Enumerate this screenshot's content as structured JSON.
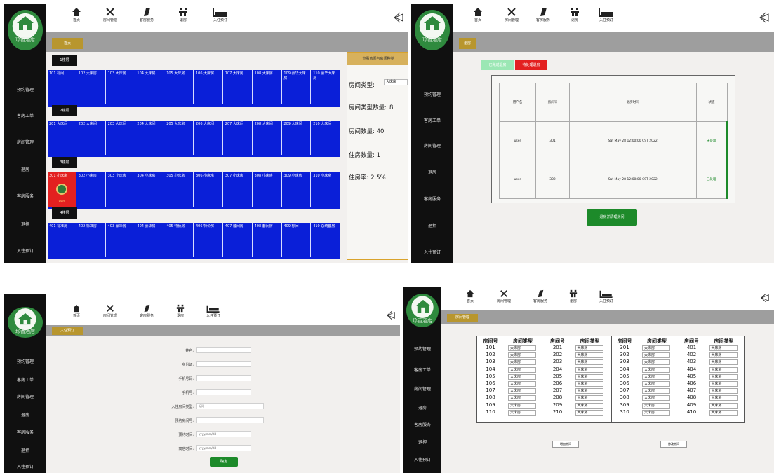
{
  "colors": {
    "sidebar": "#101010",
    "room_blue": "#0a1fd8",
    "occupied_red": "#e32020",
    "tab_gold": "#b8962e",
    "green": "#1d8a2a"
  },
  "brand": "珍香酒店",
  "toolbar": [
    {
      "icon": "home-icon",
      "label": "首页"
    },
    {
      "icon": "tools-icon",
      "label": "房间管理"
    },
    {
      "icon": "feather-icon",
      "label": "客房服务"
    },
    {
      "icon": "checkout-icon",
      "label": "退房"
    },
    {
      "icon": "reception-icon",
      "label": "入住预订"
    }
  ],
  "screen1": {
    "sidebar": [
      "预约管理",
      "客房工单",
      "房间管理",
      "退房",
      "客房服务",
      "退押",
      "入住预订"
    ],
    "tab": "首页",
    "floors": [
      {
        "label": "1楼层",
        "rooms": [
          "101 标间",
          "102 大床房",
          "103 大床房",
          "104 大床房",
          "105 大床房",
          "106 大床房",
          "107 大床房",
          "108 大床房",
          "109 豪华大床房",
          "110 豪华大床房"
        ]
      },
      {
        "label": "2楼层",
        "rooms": [
          "201 大床间",
          "202 大床间",
          "203 大床间",
          "204 大床间",
          "205 大床房",
          "206 大床间",
          "207 大床间",
          "208 大床间",
          "209 大床间",
          "210 大床间"
        ]
      },
      {
        "label": "3楼层",
        "rooms": [
          "301 小床房",
          "302 小床房",
          "303 小床房",
          "304 小床房",
          "305 小床房",
          "306 小床房",
          "307 小床房",
          "308 小床房",
          "309 小床房",
          "310 小床房"
        ]
      },
      {
        "label": "4楼层",
        "rooms": [
          "401 标准房",
          "402 标准房",
          "403 豪华房",
          "404 豪华房",
          "405 特价房",
          "406 特价房",
          "407 套间房",
          "408 套间房",
          "409 标间",
          "410 总统套房"
        ]
      }
    ],
    "occupied_badge": "user",
    "info": {
      "header": "查看房间与房间种类",
      "type_label": "房间类型:",
      "type_value": "大床房",
      "type_count_label": "房间类型数量:",
      "type_count": "8",
      "room_count": "房间数量: 40",
      "occupied": "住房数量: 1",
      "rate": "住房率: 2.5%"
    }
  },
  "screen2": {
    "sidebar": [
      "预约管理",
      "客房工单",
      "房间管理",
      "退房",
      "客房服务",
      "退押",
      "入住预订"
    ],
    "tab": "退房",
    "tab_a": "已完成退房",
    "tab_b": "待处理退房",
    "headers": [
      "用户名",
      "房间号",
      "退房时间",
      "状态"
    ],
    "rows": [
      [
        "user",
        "301",
        "Sat May 28 12:00:00 CST 2022",
        "未处理"
      ],
      [
        "user",
        "302",
        "Sat May 28 12:00:00 CST 2022",
        "已处理"
      ]
    ],
    "button": "退房并清理房间"
  },
  "screen3": {
    "sidebar": [
      "预约管理",
      "客房工单",
      "房间管理",
      "退房",
      "客房服务",
      "退押",
      "入住预订"
    ],
    "tab": "入住预订",
    "fields": [
      {
        "label": "姓名:",
        "value": ""
      },
      {
        "label": "身份证:",
        "value": ""
      },
      {
        "label": "手机号码:",
        "value": ""
      },
      {
        "label": "手机号:",
        "value": ""
      },
      {
        "label": "入住房间类型:",
        "value": "标间"
      },
      {
        "label": "预约房间号:",
        "value": ""
      },
      {
        "label": "预约时间:",
        "value": "yyyy/mm/dd"
      },
      {
        "label": "离店时间:",
        "value": "yyyy/mm/dd"
      }
    ],
    "submit": "确定"
  },
  "screen4": {
    "sidebar": [
      "预约管理",
      "客房工单",
      "房间管理",
      "退房",
      "客房服务",
      "退押",
      "入住预订"
    ],
    "tab": "房间管理",
    "col_room": "房间号",
    "col_type": "房间类型",
    "floors": [
      {
        "rooms": [
          "101",
          "102",
          "103",
          "104",
          "105",
          "106",
          "107",
          "108",
          "109",
          "110"
        ]
      },
      {
        "rooms": [
          "201",
          "202",
          "203",
          "204",
          "205",
          "206",
          "207",
          "208",
          "209",
          "210"
        ]
      },
      {
        "rooms": [
          "301",
          "302",
          "303",
          "304",
          "305",
          "306",
          "307",
          "308",
          "309",
          "310"
        ]
      },
      {
        "rooms": [
          "401",
          "402",
          "403",
          "404",
          "405",
          "406",
          "407",
          "408",
          "409",
          "410"
        ]
      }
    ],
    "types": [
      [
        "大床房",
        "大床房",
        "大床房",
        "大床房",
        "大床房",
        "大床房",
        "大床房",
        "大床房",
        "大床房",
        "大床房"
      ],
      [
        "大床房",
        "大床房",
        "大床房",
        "大床房",
        "大床房",
        "大床房",
        "大床房",
        "大床房",
        "大床房",
        "大床房"
      ],
      [
        "大床房",
        "大床房",
        "大床房",
        "大床房",
        "大床房",
        "大床房",
        "大床房",
        "大床房",
        "大床房",
        "大床房"
      ],
      [
        "大床房",
        "大床房",
        "大床房",
        "大床房",
        "大床房",
        "大床房",
        "大床房",
        "大床房",
        "大床房",
        "大床房"
      ]
    ],
    "btn_left": "增加房间",
    "btn_right": "修改房间"
  }
}
